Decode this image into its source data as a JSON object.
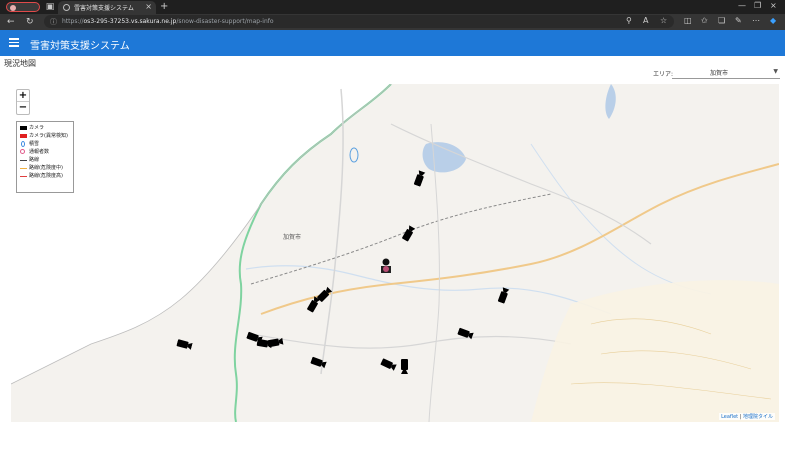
{
  "browser": {
    "tab_title": "雪害対策支援システム",
    "url_prefix": "https://",
    "url_host": "os3-295-37253.vs.sakura.ne.jp",
    "url_path": "/snow-disaster-support/map-info"
  },
  "app": {
    "title": "雪害対策支援システム"
  },
  "page": {
    "label": "現況地図",
    "area_label": "エリア:",
    "area_value": "加賀市"
  },
  "map": {
    "zoom_in": "+",
    "zoom_out": "−",
    "legend": [
      {
        "label": "カメラ",
        "symbol": "camera-black"
      },
      {
        "label": "カメラ(異常検知)",
        "symbol": "camera-red"
      },
      {
        "label": "積雪",
        "symbol": "snow-drop"
      },
      {
        "label": "通報者数",
        "symbol": "report-circle"
      },
      {
        "label": "路線",
        "symbol": "route-line"
      },
      {
        "label": "路線(危険度中)",
        "symbol": "route-medium"
      },
      {
        "label": "路線(危険度高)",
        "symbol": "route-high"
      }
    ],
    "attribution_leaflet": "Leaflet",
    "attribution_tiles": "地理院タイル",
    "place_labels": [
      "加賀市"
    ],
    "colors": {
      "sea": "#ffffff",
      "land": "#f4f2ee",
      "coast": "#7fd3a0",
      "road": "#f0c98a",
      "water_blue": "#b9cfe8"
    },
    "camera_count": 17
  }
}
